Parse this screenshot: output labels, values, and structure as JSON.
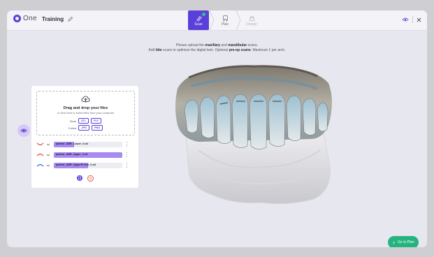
{
  "header": {
    "logo_text": "One",
    "project_name": "Training",
    "steps": [
      {
        "label": "Scan",
        "state": "active"
      },
      {
        "label": "Plan",
        "state": "default"
      },
      {
        "label": "Design",
        "state": "disabled"
      }
    ]
  },
  "instructions": {
    "line1_pre": "Please upload the ",
    "line1_b1": "maxillary",
    "line1_mid": " and ",
    "line1_b2": "mandibular",
    "line1_post": " scans.",
    "line2_pre": "Add ",
    "line2_b1": "bite",
    "line2_mid": " scans to optimize the digital twin. Optional ",
    "line2_b2": "pre-op scans",
    "line2_post": ": Maximum 1 per arch."
  },
  "upload_panel": {
    "title": "Drag and drop your files",
    "subtitle": "or click here to select files from your computer",
    "scan_label": "Scan",
    "scan_formats": [
      "STL",
      "PLY"
    ],
    "colors_label": "Colors",
    "color_formats": [
      "JPG",
      "PNG"
    ],
    "files": [
      {
        "name": "patient_ABR_Lower_0.stl",
        "progress": 0.3,
        "jaw": "lower"
      },
      {
        "name": "patient_ABR_Upper_0.stl",
        "progress": 1.0,
        "jaw": "upper"
      },
      {
        "name": "patient_ABR_UpperPreOp_0.stl",
        "progress": 0.5,
        "jaw": "upper-preop"
      }
    ]
  },
  "footer": {
    "go_to_plan_label": "Go to Plan"
  },
  "colors": {
    "accent": "#5b3fd9",
    "progress": "#a78af2",
    "success": "#25b480"
  }
}
